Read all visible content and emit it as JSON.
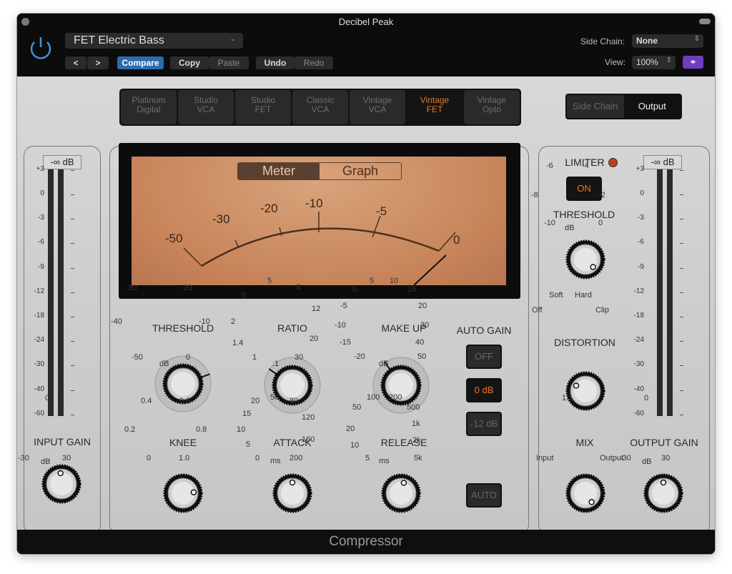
{
  "window": {
    "title": "Decibel Peak",
    "footer": "Compressor"
  },
  "header": {
    "preset": "FET Electric Bass",
    "prev_label": "<",
    "next_label": ">",
    "compare": "Compare",
    "copy": "Copy",
    "paste": "Paste",
    "undo": "Undo",
    "redo": "Redo",
    "side_chain_label": "Side Chain:",
    "side_chain_value": "None",
    "view_label": "View:",
    "view_value": "100%"
  },
  "models": [
    {
      "line1": "Platinum",
      "line2": "Digital"
    },
    {
      "line1": "Studio",
      "line2": "VCA"
    },
    {
      "line1": "Studio",
      "line2": "FET"
    },
    {
      "line1": "Classic",
      "line2": "VCA"
    },
    {
      "line1": "Vintage",
      "line2": "VCA"
    },
    {
      "line1": "Vintage",
      "line2": "FET",
      "active": true
    },
    {
      "line1": "Vintage",
      "line2": "Opto"
    }
  ],
  "side_output": {
    "side": "Side Chain",
    "output": "Output"
  },
  "meter": {
    "tab_meter": "Meter",
    "tab_graph": "Graph",
    "scale": [
      "-50",
      "-30",
      "-20",
      "-10",
      "-5",
      "0"
    ]
  },
  "level_meter": {
    "readout": "-∞ dB",
    "scale": [
      "+3",
      "0",
      "-3",
      "-6",
      "-9",
      "-12",
      "-18",
      "-24",
      "-30",
      "-40",
      "-60"
    ]
  },
  "input_gain": {
    "label": "INPUT GAIN",
    "top": "0",
    "min": "-30",
    "max": "30",
    "unit": "dB"
  },
  "threshold": {
    "label": "THRESHOLD",
    "ticks": [
      "-30",
      "-20",
      "-40",
      "-10",
      "-50",
      "0"
    ],
    "unit": "dB"
  },
  "ratio": {
    "label": "RATIO",
    "ticks": [
      "5",
      "3",
      "8",
      "12",
      "2",
      "1.4",
      "20",
      "1",
      "30"
    ],
    "unit": ":1"
  },
  "makeup": {
    "label": "MAKE UP",
    "ticks": [
      "5",
      "10",
      "0",
      "15",
      "-5",
      "20",
      "-10",
      "30",
      "-15",
      "40",
      "-20",
      "50"
    ],
    "unit": "dB"
  },
  "auto_gain": {
    "label": "AUTO GAIN",
    "off": "OFF",
    "zero": "0 dB",
    "minus12": "-12 dB",
    "auto": "AUTO"
  },
  "knee": {
    "label": "KNEE",
    "ticks": [
      "0.4",
      "0.6",
      "0.2",
      "0.8",
      "0",
      "1.0"
    ]
  },
  "attack": {
    "label": "ATTACK",
    "ticks": [
      "20",
      "50",
      "80",
      "15",
      "120",
      "10",
      "160",
      "5",
      "0",
      "200"
    ],
    "unit": "ms"
  },
  "release": {
    "label": "RELEASE",
    "ticks": [
      "100",
      "200",
      "50",
      "500",
      "20",
      "1k",
      "10",
      "2k",
      "5",
      "5k"
    ],
    "unit": "ms"
  },
  "limiter": {
    "label": "LIMITER",
    "on": "ON",
    "threshold_label": "THRESHOLD",
    "ticks": [
      "-6",
      "-4",
      "-8",
      "-2",
      "-10",
      "0"
    ],
    "unit": "dB"
  },
  "distortion": {
    "label": "DISTORTION",
    "ticks": [
      "Soft",
      "Hard",
      "Off",
      "Clip"
    ]
  },
  "mix": {
    "label": "MIX",
    "top": "1:1",
    "left": "Input",
    "right": "Output"
  },
  "output_gain": {
    "label": "OUTPUT GAIN",
    "top": "0",
    "min": "-30",
    "max": "30",
    "unit": "dB"
  }
}
